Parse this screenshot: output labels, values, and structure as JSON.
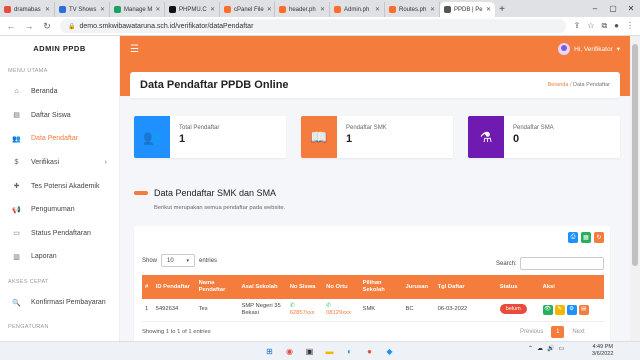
{
  "browser": {
    "tabs": [
      {
        "label": "dramabas",
        "color": "#e74c3c"
      },
      {
        "label": "TV Shows",
        "color": "#2d6cdf"
      },
      {
        "label": "Manage M",
        "color": "#1aa260"
      },
      {
        "label": "PHPMU.C",
        "color": "#111111"
      },
      {
        "label": "cPanel File",
        "color": "#ff6c2c"
      },
      {
        "label": "header.ph",
        "color": "#ff6c2c"
      },
      {
        "label": "Admin.ph",
        "color": "#ff6c2c"
      },
      {
        "label": "Routes.ph",
        "color": "#ff6c2c"
      },
      {
        "label": "PPDB | Pe",
        "color": "#555555",
        "active": true
      }
    ],
    "new_tab": "+",
    "url": "demo.smkwibawataruna.sch.id/verifikator/dataPendaftar"
  },
  "sidebar": {
    "brand": "ADMIN PPDB",
    "section_main": "MENU UTAMA",
    "items": [
      {
        "label": "Beranda",
        "icon": "home-icon",
        "glyph": "⌂"
      },
      {
        "label": "Daftar Siswa",
        "icon": "book-icon",
        "glyph": "▤"
      },
      {
        "label": "Data Pendaftar",
        "icon": "users-icon",
        "glyph": "👥",
        "active": true
      },
      {
        "label": "Verifikasi",
        "icon": "dollar-icon",
        "glyph": "$",
        "chevron": true
      },
      {
        "label": "Tes Potensi Akademik",
        "icon": "user-plus-icon",
        "glyph": "✚"
      },
      {
        "label": "Pengumuman",
        "icon": "bullhorn-icon",
        "glyph": "📢"
      },
      {
        "label": "Status Pendaftaran",
        "icon": "file-icon",
        "glyph": "▭"
      },
      {
        "label": "Laporan",
        "icon": "chart-icon",
        "glyph": "▥"
      }
    ],
    "section_quick": "AKSES CEPAT",
    "quick_items": [
      {
        "label": "Konfirmasi Pembayaran",
        "icon": "search-icon",
        "glyph": "🔍"
      }
    ],
    "section_settings": "PENGATURAN"
  },
  "topbar": {
    "user": "Hi, Verifikator"
  },
  "page": {
    "title": "Data Pendaftar PPDB Online",
    "breadcrumb_home": "Beranda",
    "breadcrumb_sep": "/",
    "breadcrumb_current": "Data Pendaftar"
  },
  "stats": [
    {
      "label": "Total Pendaftar",
      "value": "1",
      "color": "#1e90ff",
      "icon": "users-icon",
      "glyph": "👥"
    },
    {
      "label": "Pendaftar SMK",
      "value": "1",
      "color": "#f47c3c",
      "icon": "book-open-icon",
      "glyph": "📖"
    },
    {
      "label": "Pendaftar SMA",
      "value": "0",
      "color": "#6f1ab1",
      "icon": "flask-icon",
      "glyph": "⚗"
    }
  ],
  "section": {
    "title": "Data Pendaftar SMK dan SMA",
    "desc": "Berikut merupakan semua pendaftar pada website."
  },
  "table_tools": {
    "show_label": "Show",
    "entries_value": "10",
    "entries_label": "entries",
    "search_label": "Search:",
    "export_buttons": [
      {
        "icon": "print-icon",
        "glyph": "⎙",
        "color": "#1e90ff"
      },
      {
        "icon": "excel-icon",
        "glyph": "▦",
        "color": "#27ae60"
      },
      {
        "icon": "refresh-icon",
        "glyph": "↻",
        "color": "#f47c3c"
      }
    ]
  },
  "table": {
    "columns": [
      "#",
      "ID Pendaftar",
      "Nama Pendaftar",
      "Asal Sekolah",
      "No Siswa",
      "No Ortu",
      "Pilihan Sekolah",
      "Jurusan",
      "Tgl Daftar",
      "Status",
      "Aksi"
    ],
    "rows": [
      {
        "no": "1",
        "id": "5492634",
        "nama": "Tes",
        "asal": "SMP Negeri 35 Bekasi",
        "no_siswa": "62857xxx",
        "no_ortu": "08129xxx",
        "pilihan": "SMK",
        "jurusan": "BC",
        "tgl": "06-03-2022",
        "status": "belum"
      }
    ],
    "info": "Showing 1 to 1 of 1 entries",
    "prev": "Previous",
    "page": "1",
    "next": "Next"
  },
  "taskbar": {
    "time": "4:49 PM",
    "date": "3/6/2022"
  }
}
